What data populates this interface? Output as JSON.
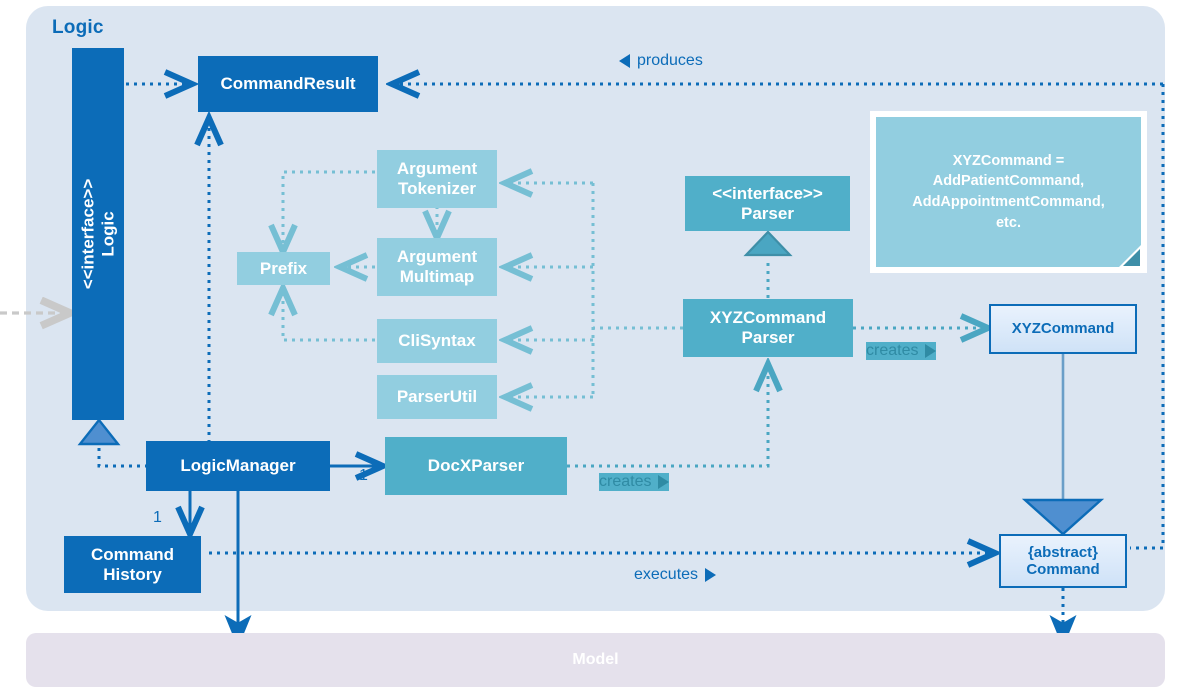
{
  "diagram": {
    "title": "Logic",
    "model_title": "Model"
  },
  "nodes": {
    "logic_interface": {
      "stereotype": "<<interface>>",
      "name": "Logic"
    },
    "command_result": {
      "name": "CommandResult"
    },
    "argument_tokenizer": {
      "line1": "Argument",
      "line2": "Tokenizer"
    },
    "argument_multimap": {
      "line1": "Argument",
      "line2": "Multimap"
    },
    "prefix": {
      "name": "Prefix"
    },
    "cli_syntax": {
      "name": "CliSyntax"
    },
    "parser_util": {
      "name": "ParserUtil"
    },
    "parser_interface": {
      "stereotype": "<<interface>>",
      "name": "Parser"
    },
    "xyz_command_parser": {
      "line1": "XYZCommand",
      "line2": "Parser"
    },
    "xyz_command": {
      "name": "XYZCommand"
    },
    "abstract_command": {
      "line1": "{abstract}",
      "line2": "Command"
    },
    "logic_manager": {
      "name": "LogicManager"
    },
    "command_history": {
      "line1": "Command",
      "line2": "History"
    },
    "docx_parser": {
      "name": "DocXParser"
    },
    "note": {
      "line1": "XYZCommand =",
      "line2": "AddPatientCommand,",
      "line3": "AddAppointmentCommand,",
      "line4": "etc."
    }
  },
  "edge_labels": {
    "produces": "produces",
    "creates_parser": "creates",
    "creates_command": "creates",
    "executes": "executes"
  },
  "multiplicities": {
    "logic_manager_to_command_history": "1",
    "logic_manager_to_docx_parser": "1"
  },
  "colors": {
    "panel_bg": "#dbe5f1",
    "model_bg": "#e5e1ec",
    "dark_blue": "#0c6cb8",
    "teal": "#50afc9",
    "light_teal": "#92cee0",
    "accent_text": "#0c6cb8",
    "external_arrow": "#c9c9c9"
  }
}
